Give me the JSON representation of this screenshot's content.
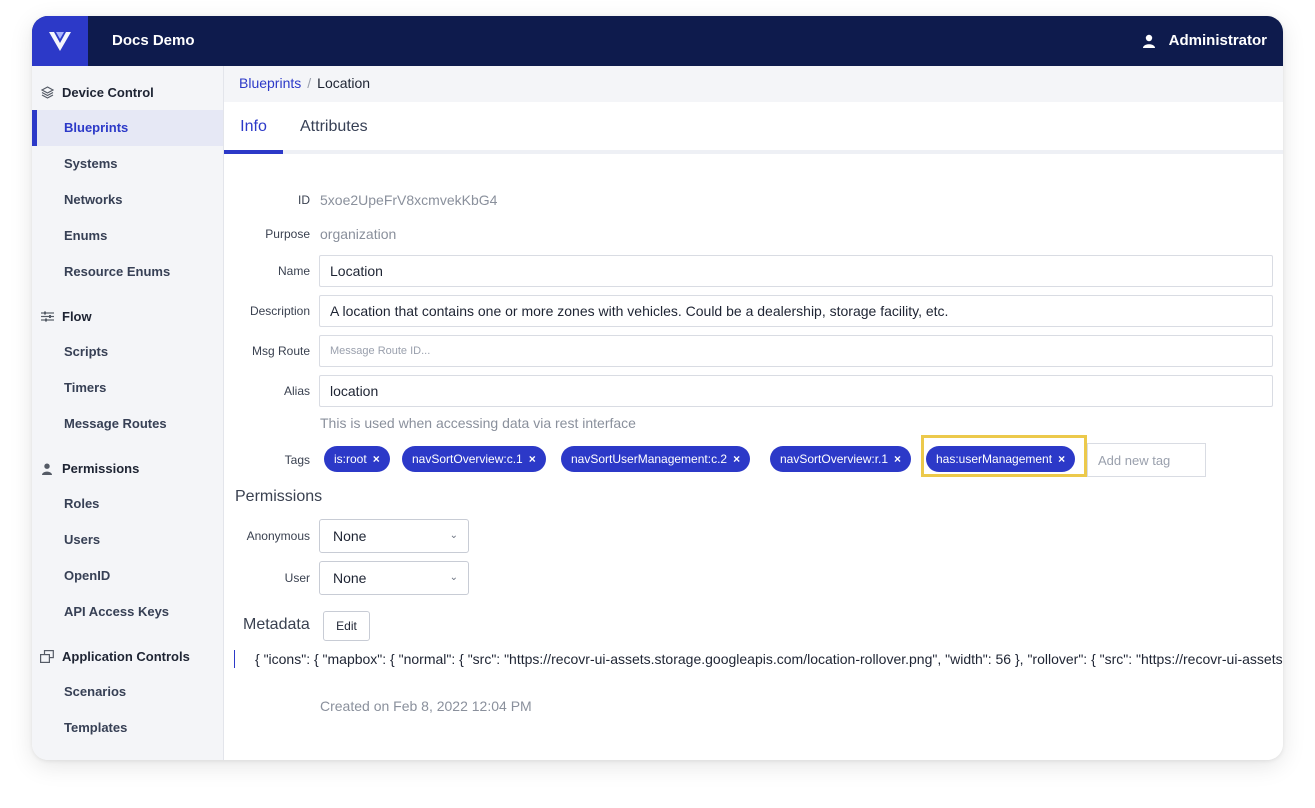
{
  "app": {
    "title": "Docs Demo",
    "user": "Administrator"
  },
  "sidebar": {
    "sections": [
      {
        "label": "Device Control",
        "icon": "layers-icon"
      },
      {
        "label": "Flow",
        "icon": "sliders-icon"
      },
      {
        "label": "Permissions",
        "icon": "person-icon"
      },
      {
        "label": "Application Controls",
        "icon": "windows-icon"
      }
    ],
    "items": [
      "Blueprints",
      "Systems",
      "Networks",
      "Enums",
      "Resource Enums",
      "Scripts",
      "Timers",
      "Message Routes",
      "Roles",
      "Users",
      "OpenID",
      "API Access Keys",
      "Scenarios",
      "Templates"
    ],
    "active": "Blueprints"
  },
  "breadcrumb": {
    "parent": "Blueprints",
    "separator": "/",
    "current": "Location"
  },
  "tabs": [
    "Info",
    "Attributes"
  ],
  "form": {
    "id_label": "ID",
    "id_value": "5xoe2UpeFrV8xcmvekKbG4",
    "purpose_label": "Purpose",
    "purpose_value": "organization",
    "name_label": "Name",
    "name_value": "Location",
    "description_label": "Description",
    "description_value": "A location that contains one or more zones with vehicles. Could be a dealership, storage facility, etc.",
    "msg_route_label": "Msg Route",
    "msg_route_placeholder": "Message Route ID...",
    "alias_label": "Alias",
    "alias_value": "location",
    "alias_help": "This is used when accessing data via rest interface",
    "tags_label": "Tags",
    "tags": [
      "is:root",
      "navSortOverview:c.1",
      "navSortUserManagement:c.2",
      "navSortOverview:r.1",
      "has:userManagement"
    ],
    "tag_remove": "×",
    "new_tag_placeholder": "Add new tag"
  },
  "permissions": {
    "title": "Permissions",
    "anonymous_label": "Anonymous",
    "anonymous_value": "None",
    "user_label": "User",
    "user_value": "None"
  },
  "metadata": {
    "title": "Metadata",
    "edit_label": "Edit",
    "json": "{ \"icons\": { \"mapbox\": { \"normal\": { \"src\": \"https://recovr-ui-assets.storage.googleapis.com/location-rollover.png\", \"width\": 56 }, \"rollover\": { \"src\": \"https://recovr-ui-assets.storage.googleapis.com/location-rollover.png\" } } } }"
  },
  "created": "Created on Feb 8, 2022 12:04 PM",
  "colors": {
    "topbar": "#0e1b4d",
    "accent": "#2c39c8",
    "highlight": "#ecc94b"
  }
}
